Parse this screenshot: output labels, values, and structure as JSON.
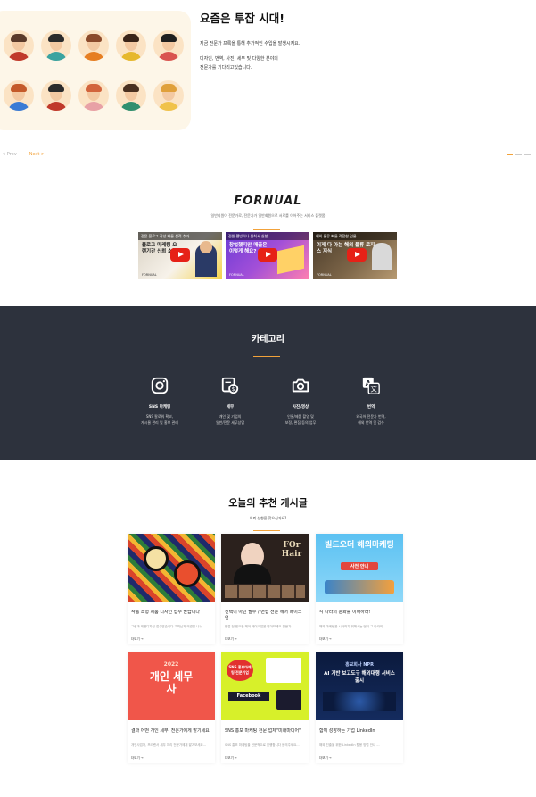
{
  "hero": {
    "title": "요즘은 투잡 시대!",
    "desc_line1": "지금 전문가 프록을 통해 추가적인 수입을 발생시켜요.",
    "desc_line2": "디자인, 번역, 사진, 세무 및 다양한 분야의",
    "desc_line3": "전문가를 기다리고있습니다.",
    "prev_label": "< Prev",
    "next_label": "Next >"
  },
  "brand": {
    "logo": "FORNUAL",
    "subtitle": "일반회원이 전문가로, 전문가가 일반회원으로 서로를 이어주는 서비스 플랫폼",
    "videos": [
      {
        "top": "전문 블로그 작성 빠른 실적 추가",
        "caption": "블로그 마케팅 오랜기간 신뢰 소통",
        "footer": "FORNUAL"
      },
      {
        "top": "전원 웰빙이나 원칙서 실천",
        "caption": "창업했지만 매출은 이렇게 해요?",
        "footer": "FORNUAL"
      },
      {
        "top": "해외 물류 빠른 적합한 인물",
        "caption": "이게 다 아는 해외 물류 로지스 지식",
        "footer": "FORNUAL"
      }
    ]
  },
  "category": {
    "title": "카테고리",
    "items": [
      {
        "icon": "instagram-icon",
        "name": "SNS 마케팅",
        "desc1": "SNS 팔로워 확보,",
        "desc2": "게시물 관리 및 홍보 관리"
      },
      {
        "icon": "tax-document-icon",
        "name": "세무",
        "desc1": "개인 및 기업의",
        "desc2": "일반/전문 세무상담"
      },
      {
        "icon": "camera-icon",
        "name": "사진/영상",
        "desc1": "인물/제품 촬영 및",
        "desc2": "보정, 편집 등의 업무"
      },
      {
        "icon": "translate-icon",
        "name": "번역",
        "desc1": "외국어 전문가 번역,",
        "desc2": "해외 번역 및 검수"
      }
    ]
  },
  "recommend": {
    "title": "오늘의 추천 게시글",
    "subtitle": "의뢰 성향을 찾으신가요?",
    "more_label": "더보기 →",
    "posts": [
      {
        "title": "작품 소형 제품 디자인 접수 받습니다",
        "desc": "그림과 제품디자인 접수받습니다 고객님과 의견을 나누...",
        "thumb": "illustration"
      },
      {
        "title": "선택이 아닌 필수 / 면접 전문 헤어 메이크업",
        "desc": "면접 전 필요한 헤어 메이크업을 받아보세요 전문가...",
        "thumb": "hair"
      },
      {
        "title": "각 나라의 문화를 이해하라!",
        "desc": "해외 마케팅을 시작하기 위해서는 먼저 그 나라의...",
        "thumb": "marketing"
      },
      {
        "title": "결과 어떤 개인 세무, 전문가에게 맡기세요!",
        "desc": "개인사업자, 프리랜서 세무 처리 전문가에게 맡겨보세요...",
        "thumb": "tax"
      },
      {
        "title": "SNS 홍보 마케팅 전문 업체\"미래마디어\"",
        "desc": "SNS 홍보 마케팅을 전문적으로 진행합니다 문의주세요...",
        "thumb": "sns"
      },
      {
        "title": "함께 성장하는 기업 LinkedIn",
        "desc": "해외 진출을 위한 LinkedIn 활용 방법 안내 ...",
        "thumb": "npr"
      }
    ],
    "thumb_texts": {
      "hair_main": "FOr Hair",
      "marketing_main": "빌드오더 해외마케팅",
      "marketing_sub": "사전 안내",
      "tax_year": "2022",
      "tax_main": "개인 세무사",
      "sns_main": "SNS 홍보마케팅 전문기업",
      "sns_sub": "Facebook",
      "npr_top": "홍보회사 NPR",
      "npr_main": "AI 기반 보고도구 해외대행 서비스 출시"
    }
  },
  "colors": {
    "accent": "#f2a23a",
    "dark_band": "#2d323d"
  }
}
